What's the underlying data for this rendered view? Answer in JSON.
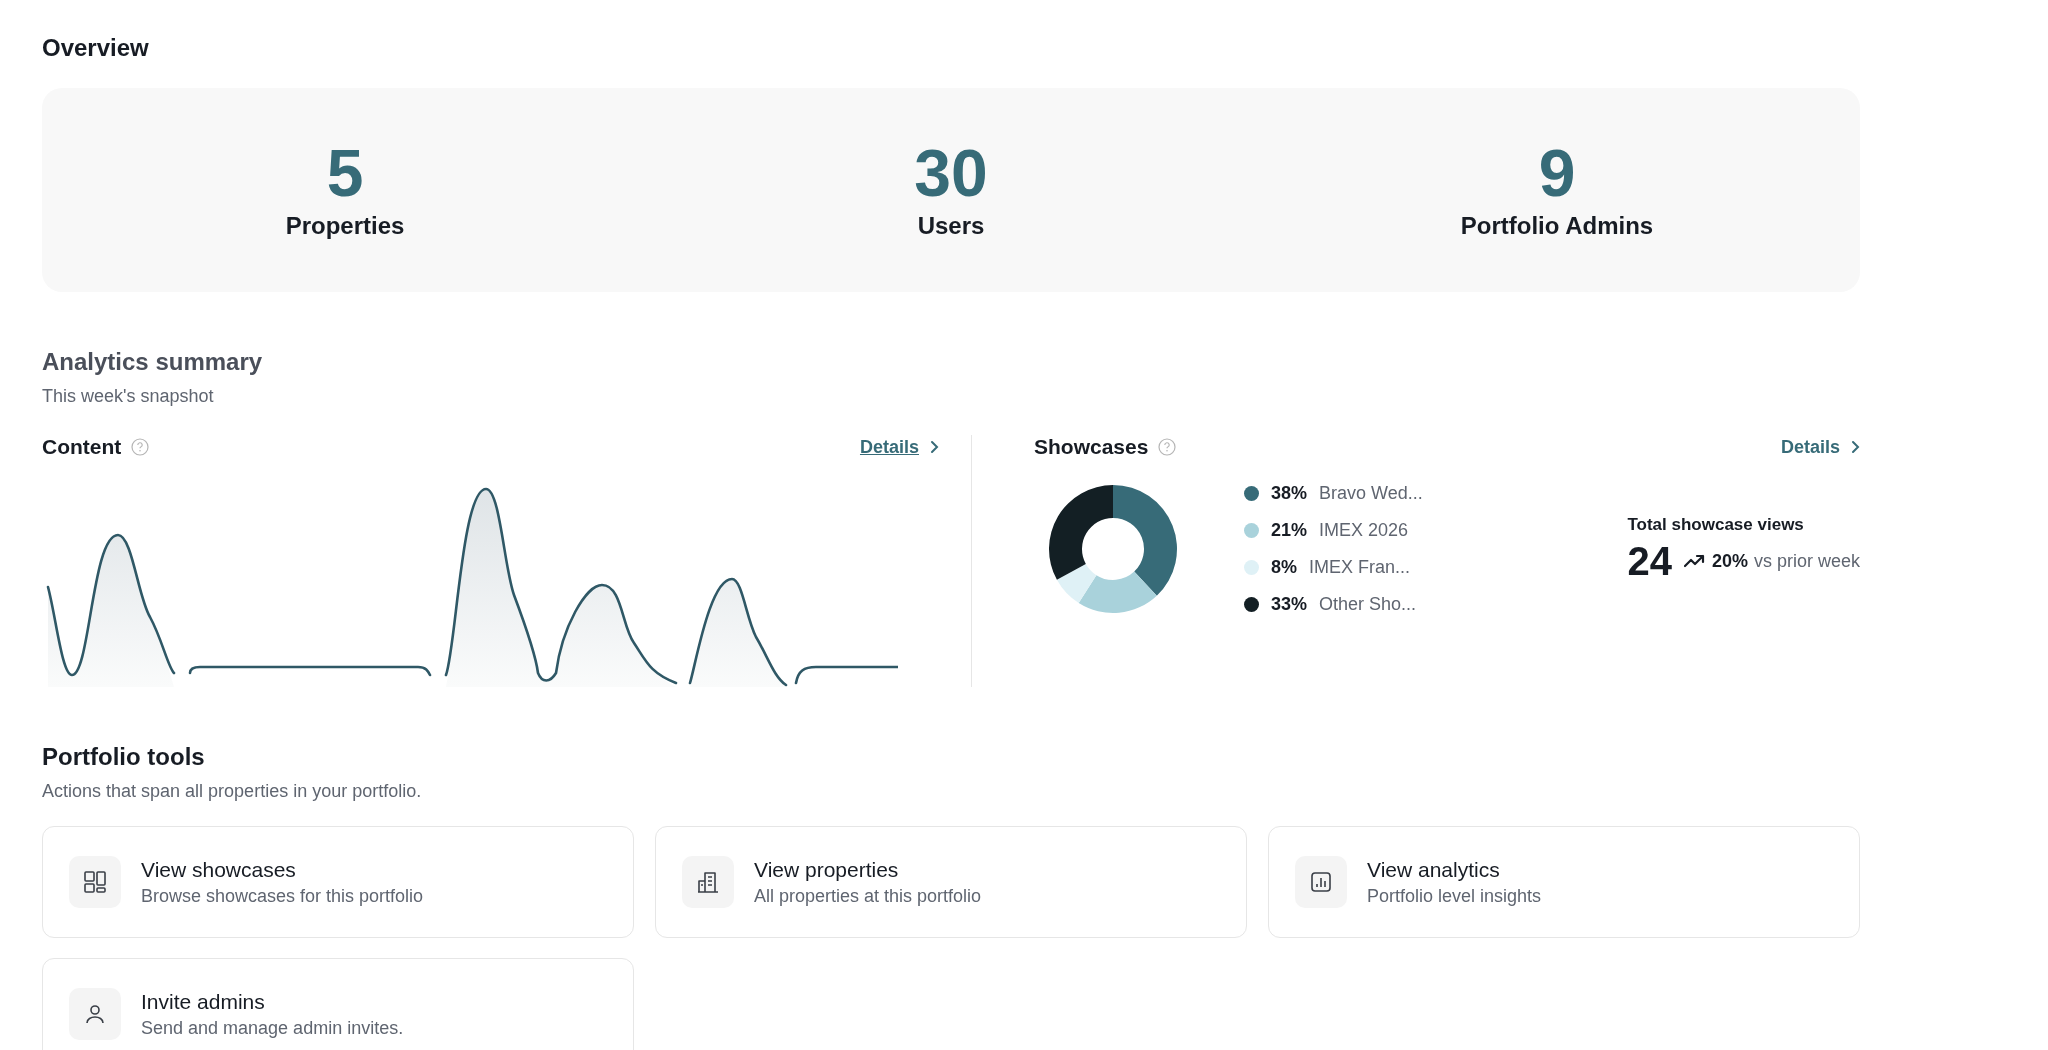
{
  "overview": {
    "title": "Overview",
    "stats": [
      {
        "value": "5",
        "label": "Properties"
      },
      {
        "value": "30",
        "label": "Users"
      },
      {
        "value": "9",
        "label": "Portfolio Admins"
      }
    ]
  },
  "analytics": {
    "title": "Analytics summary",
    "subtitle": "This week's snapshot",
    "content": {
      "title": "Content",
      "link": "Details"
    },
    "showcases": {
      "title": "Showcases",
      "link": "Details",
      "legend": [
        {
          "percent": "38%",
          "color": "#376b78"
        },
        {
          "percent": "21%",
          "color": "#a9d2db"
        },
        {
          "percent": "8%",
          "color": "#dff1f6"
        },
        {
          "percent": "33%",
          "color": "#131f24"
        }
      ],
      "chart_data": {
        "type": "donut",
        "categories": [
          "Bravo Wed...",
          "IMEX 2026",
          "IMEX Fran...",
          "Other Sho..."
        ],
        "values": [
          38,
          21,
          8,
          33
        ]
      },
      "total": {
        "label": "Total showcase views",
        "value": "24",
        "change": "20%",
        "comparison": "vs prior week"
      }
    }
  },
  "tools": {
    "title": "Portfolio tools",
    "subtitle": "Actions that span all properties in your portfolio.",
    "cards": [
      {
        "kind": "showcases",
        "title": "View showcases",
        "description": "Browse showcases for this portfolio"
      },
      {
        "kind": "properties",
        "title": "View properties",
        "description": "All properties at this portfolio"
      },
      {
        "kind": "analytics",
        "title": "View analytics",
        "description": "Portfolio level insights"
      },
      {
        "kind": "admins",
        "title": "Invite admins",
        "description": "Send and manage admin invites."
      }
    ]
  }
}
